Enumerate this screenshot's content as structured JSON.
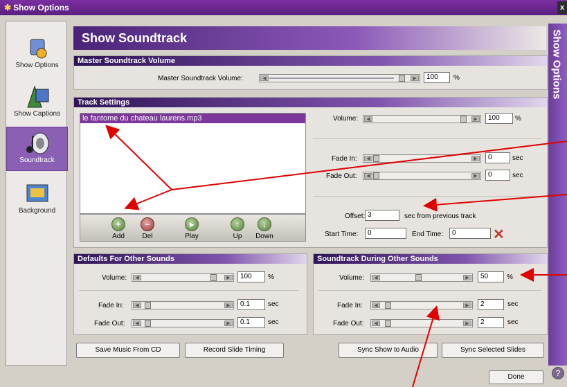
{
  "window": {
    "title": "Show Options",
    "close": "x"
  },
  "sidebar": {
    "items": [
      {
        "label": "Show Options",
        "icon": "show-options-icon"
      },
      {
        "label": "Show Captions",
        "icon": "captions-icon"
      },
      {
        "label": "Soundtrack",
        "icon": "speaker-icon"
      },
      {
        "label": "Background",
        "icon": "background-icon"
      }
    ]
  },
  "header": {
    "title": "Show Soundtrack"
  },
  "right_strip": {
    "label": "Show Options"
  },
  "master": {
    "section": "Master Soundtrack Volume",
    "label": "Master Soundtrack Volume:",
    "value": "100",
    "unit": "%",
    "level": 1.0
  },
  "track": {
    "section": "Track Settings",
    "file": "le fantome du chateau laurens.mp3",
    "volume_label": "Volume:",
    "volume": "100",
    "volume_unit": "%",
    "fade_in_label": "Fade In:",
    "fade_in": "0",
    "fade_out_label": "Fade Out:",
    "fade_out": "0",
    "sec": "sec",
    "offset_label": "Offset:",
    "offset": "3",
    "offset_suffix": "sec from previous track",
    "start_label": "Start Time:",
    "start": "0",
    "end_label": "End Time:",
    "end": "0",
    "buttons": [
      "Add",
      "Del",
      "Play",
      "Up",
      "Down"
    ]
  },
  "defaults": {
    "section": "Defaults For Other Sounds",
    "volume_label": "Volume:",
    "volume": "100",
    "unit": "%",
    "fade_in_label": "Fade In:",
    "fade_in": "0.1",
    "fade_out_label": "Fade Out:",
    "fade_out": "0.1",
    "sec": "sec"
  },
  "during": {
    "section": "Soundtrack During Other Sounds",
    "volume_label": "Volume:",
    "volume": "50",
    "unit": "%",
    "fade_in_label": "Fade In:",
    "fade_in": "2",
    "fade_out_label": "Fade Out:",
    "fade_out": "2",
    "sec": "sec"
  },
  "bottom_buttons": {
    "save": "Save Music From CD",
    "record": "Record Slide Timing",
    "sync_show": "Sync Show to Audio",
    "sync_selected": "Sync Selected Slides",
    "done": "Done"
  },
  "help": "?",
  "colors": {
    "accent": "#7b3799",
    "annotation": "#e00000"
  }
}
